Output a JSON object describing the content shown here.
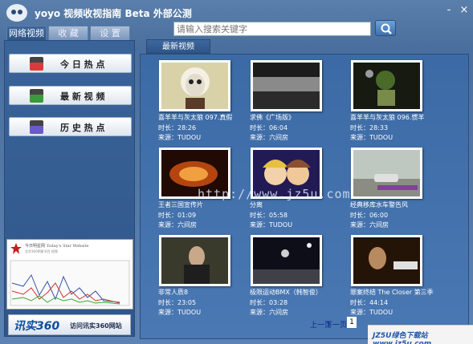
{
  "app": {
    "title": "yoyo 视频收视指南 Beta 外部公测",
    "min_label": "-",
    "close_label": "×"
  },
  "search": {
    "placeholder": "请输入搜索关键字"
  },
  "left_tabs": [
    {
      "label": "网络视频"
    },
    {
      "label": "收 藏"
    },
    {
      "label": "设 置"
    }
  ],
  "nav": [
    {
      "label": "今 日 热 点",
      "icon": "hot-icon",
      "color": "#d93b3b"
    },
    {
      "label": "最 新 视 频",
      "icon": "new-video-icon",
      "color": "#3a9a3a"
    },
    {
      "label": "历 史 热 点",
      "icon": "history-icon",
      "color": "#6a5acd"
    }
  ],
  "site_preview": {
    "title": "今日明星网 Today's Star Website",
    "subtitle": "北京360明星节目 视频"
  },
  "banner": {
    "logo": "讯实360",
    "label": "访问讯实360网站"
  },
  "right_tab": {
    "label": "最新视频"
  },
  "videos": [
    {
      "title": "喜羊羊与灰太狼 097.真假",
      "duration": "时长：28:26",
      "source": "来源：TUDOU"
    },
    {
      "title": "求佛《广场版》",
      "duration": "时长：06:04",
      "source": "来源：六间房"
    },
    {
      "title": "喜羊羊与灰太狼 096.惯羊",
      "duration": "时长：28:33",
      "source": "来源：TUDOU"
    },
    {
      "title": "王者三国宣传片",
      "duration": "时长：01:09",
      "source": "来源：六间房"
    },
    {
      "title": "分离",
      "duration": "时长：05:58",
      "source": "来源：TUDOU"
    },
    {
      "title": "经典移库水车警告风",
      "duration": "时长：06:00",
      "source": "来源：六间房"
    },
    {
      "title": "非常人质8",
      "duration": "时长：23:05",
      "source": "来源：TUDOU"
    },
    {
      "title": "极限运动BMX（韩智俊）",
      "duration": "时长：03:28",
      "source": "来源：六间房"
    },
    {
      "title": "罪案终结 The Closer 第三季",
      "duration": "时长：44:14",
      "source": "来源：TUDOU"
    }
  ],
  "pager": {
    "prev": "上一页",
    "next": "下一页",
    "current": "1"
  },
  "watermark": "http://www.jz5u.com",
  "corner_badge": "JZ5U绿色下载站 www.jz5u.com"
}
